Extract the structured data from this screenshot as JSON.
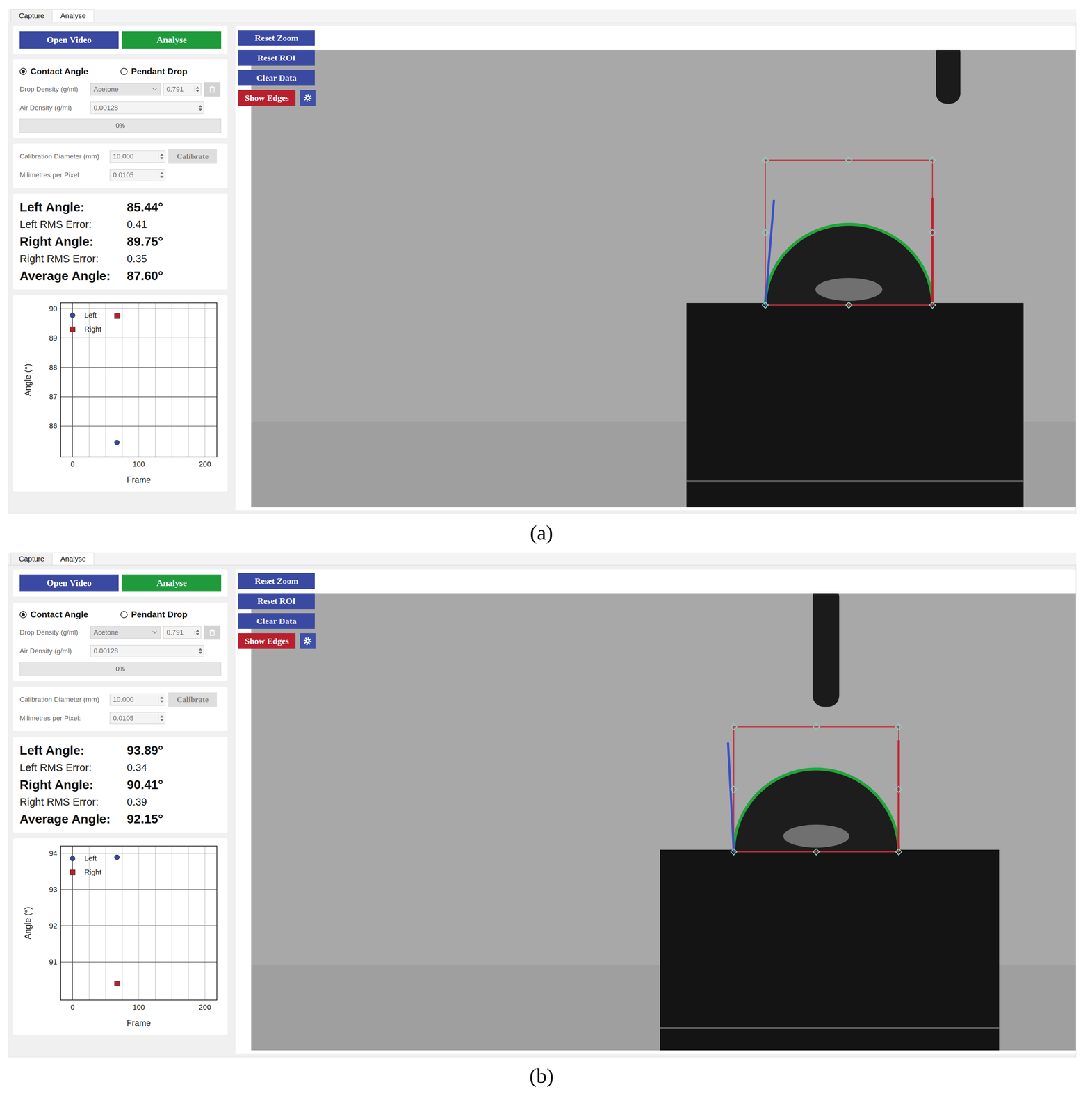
{
  "panels": [
    {
      "caption": "(a)",
      "tabs": [
        {
          "label": "Capture",
          "selected": false
        },
        {
          "label": "Analyse",
          "selected": true
        }
      ],
      "actions": {
        "open": "Open Video",
        "analyse": "Analyse"
      },
      "modes": [
        {
          "label": "Contact Angle",
          "selected": true
        },
        {
          "label": "Pendant Drop",
          "selected": false
        }
      ],
      "drop_density": {
        "label": "Drop Density (g/ml)",
        "liquid": "Acetone",
        "value": "0.791",
        "disabled": true
      },
      "air_density": {
        "label": "Air Density (g/ml)",
        "value": "0.00128",
        "disabled": true
      },
      "progress": {
        "text": "0%",
        "level": 0
      },
      "calibration": {
        "label": "Calibration Diameter (mm)",
        "value": "10.000",
        "button": "Calibrate",
        "disabled": true
      },
      "scale": {
        "label": "Milimetres per Pixel:",
        "value": "0.0105",
        "disabled": true
      },
      "results": [
        {
          "label": "Left Angle:",
          "value": "85.44°",
          "kind": "angle"
        },
        {
          "label": "Left RMS Error:",
          "value": "0.41",
          "kind": "error"
        },
        {
          "label": "Right Angle:",
          "value": "89.75°",
          "kind": "angle"
        },
        {
          "label": "Right RMS Error:",
          "value": "0.35",
          "kind": "error"
        },
        {
          "label": "Average Angle:",
          "value": "87.60°",
          "kind": "angle"
        }
      ],
      "chart": {
        "y_label": "Angle (°)",
        "x_label": "Frame",
        "y_ticks": [
          "90",
          "89",
          "88",
          "87",
          "86"
        ],
        "x_ticks": [
          "0",
          "100",
          "200"
        ],
        "series": [
          {
            "name": "Left",
            "kind": "circle",
            "color": "#34479a",
            "frames": [
              67
            ],
            "values": [
              85.44
            ]
          },
          {
            "name": "Right",
            "kind": "square",
            "color": "#b3212c",
            "frames": [
              67
            ],
            "values": [
              89.75
            ]
          }
        ]
      },
      "view_buttons": [
        {
          "label": "Reset Zoom",
          "active": false
        },
        {
          "label": "Reset ROI",
          "active": false
        },
        {
          "label": "Clear Data",
          "active": false
        },
        {
          "label": "Show Edges",
          "active": true
        }
      ]
    },
    {
      "caption": "(b)",
      "tabs": [
        {
          "label": "Capture",
          "selected": false
        },
        {
          "label": "Analyse",
          "selected": true
        }
      ],
      "actions": {
        "open": "Open Video",
        "analyse": "Analyse"
      },
      "modes": [
        {
          "label": "Contact Angle",
          "selected": true
        },
        {
          "label": "Pendant Drop",
          "selected": false
        }
      ],
      "drop_density": {
        "label": "Drop Density (g/ml)",
        "liquid": "Acetone",
        "value": "0.791",
        "disabled": true
      },
      "air_density": {
        "label": "Air Density (g/ml)",
        "value": "0.00128",
        "disabled": true
      },
      "progress": {
        "text": "0%",
        "level": 0
      },
      "calibration": {
        "label": "Calibration Diameter (mm)",
        "value": "10.000",
        "button": "Calibrate",
        "disabled": true
      },
      "scale": {
        "label": "Milimetres per Pixel:",
        "value": "0.0105",
        "disabled": true
      },
      "results": [
        {
          "label": "Left Angle:",
          "value": "93.89°",
          "kind": "angle"
        },
        {
          "label": "Left RMS Error:",
          "value": "0.34",
          "kind": "error"
        },
        {
          "label": "Right Angle:",
          "value": "90.41°",
          "kind": "angle"
        },
        {
          "label": "Right RMS Error:",
          "value": "0.39",
          "kind": "error"
        },
        {
          "label": "Average Angle:",
          "value": "92.15°",
          "kind": "angle"
        }
      ],
      "chart": {
        "y_label": "Angle (°)",
        "x_label": "Frame",
        "y_ticks": [
          "94",
          "93",
          "92",
          "91"
        ],
        "x_ticks": [
          "0",
          "100",
          "200"
        ],
        "series": [
          {
            "name": "Left",
            "kind": "circle",
            "color": "#34479a",
            "frames": [
              67
            ],
            "values": [
              93.89
            ]
          },
          {
            "name": "Right",
            "kind": "square",
            "color": "#b3212c",
            "frames": [
              67
            ],
            "values": [
              90.41
            ]
          }
        ]
      },
      "view_buttons": [
        {
          "label": "Reset Zoom",
          "active": false
        },
        {
          "label": "Reset ROI",
          "active": false
        },
        {
          "label": "Clear Data",
          "active": false
        },
        {
          "label": "Show Edges",
          "active": true
        }
      ]
    }
  ]
}
